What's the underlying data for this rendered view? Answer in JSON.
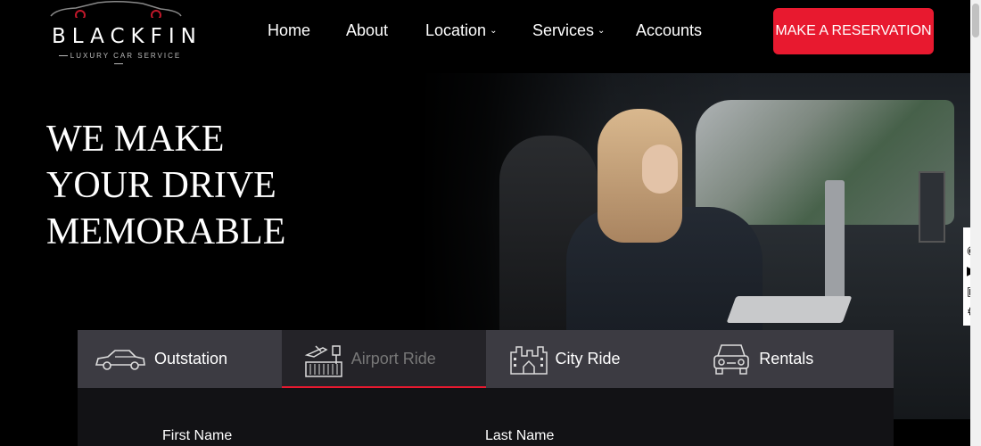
{
  "brand": {
    "name": "BLACKFIN",
    "tagline": "LUXURY CAR SERVICE"
  },
  "nav": {
    "items": [
      {
        "label": "Home",
        "has_dropdown": false
      },
      {
        "label": "About",
        "has_dropdown": false
      },
      {
        "label": "Location",
        "has_dropdown": true
      },
      {
        "label": "Services",
        "has_dropdown": true
      },
      {
        "label": "Accounts",
        "has_dropdown": false
      }
    ],
    "cta_label": "MAKE A RESERVATION"
  },
  "hero": {
    "headline_lines": [
      "WE MAKE",
      "YOUR DRIVE",
      "MEMORABLE"
    ]
  },
  "booking": {
    "tabs": [
      {
        "label": "Outstation",
        "icon": "car-icon",
        "active": false
      },
      {
        "label": "Airport Ride",
        "icon": "airport-icon",
        "active": true
      },
      {
        "label": "City Ride",
        "icon": "city-icon",
        "active": false
      },
      {
        "label": "Rentals",
        "icon": "rental-car-icon",
        "active": false
      }
    ],
    "fields": {
      "first_name_label": "First Name",
      "last_name_label": "Last Name"
    }
  },
  "colors": {
    "accent": "#e8192f",
    "background": "#000000",
    "tabbar": "#3c3b42"
  }
}
